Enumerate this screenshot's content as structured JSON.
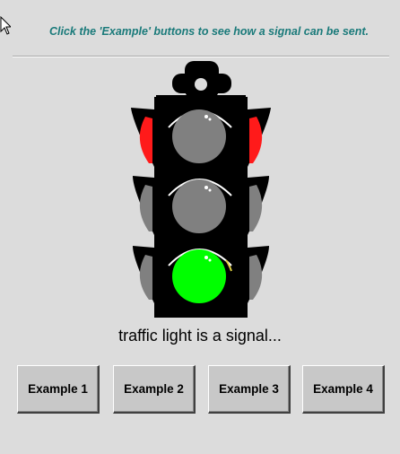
{
  "instruction": "Click the 'Example' buttons to see how a signal can be sent.",
  "caption": "traffic light is a signal...",
  "buttons": [
    {
      "label": "Example 1"
    },
    {
      "label": "Example 2"
    },
    {
      "label": "Example 3"
    },
    {
      "label": "Example 4"
    }
  ],
  "traffic_light": {
    "top_lamp": "off",
    "middle_lamp": "off",
    "bottom_lamp": "green",
    "side_flash_color": "#ff1a1a"
  },
  "colors": {
    "instruction_text": "#1a7a7a",
    "background": "#dcdcdc",
    "lamp_off": "#808080",
    "lamp_green": "#00ff00"
  },
  "icons": [
    "cursor-icon"
  ]
}
